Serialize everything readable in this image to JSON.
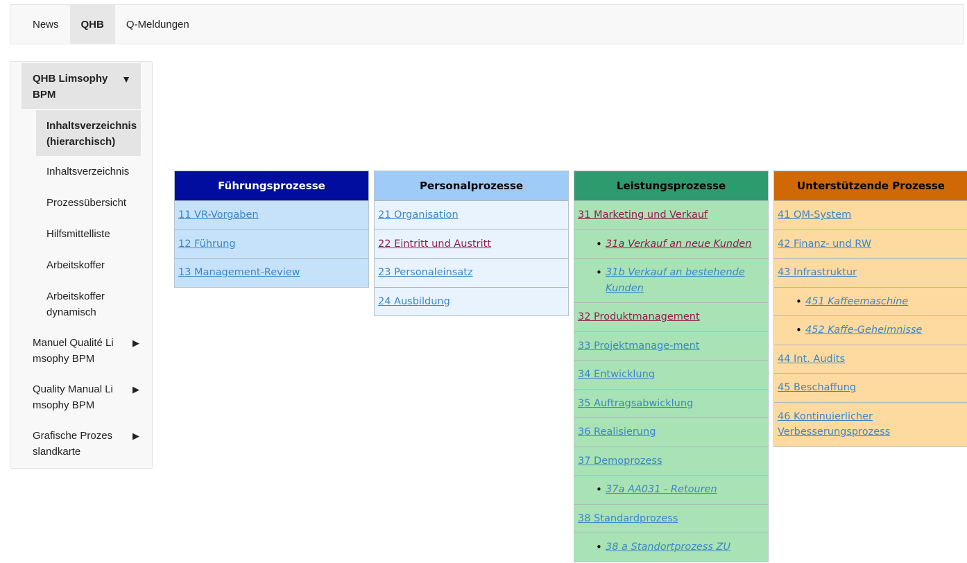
{
  "topnav": {
    "tabs": [
      "News",
      "QHB",
      "Q-Meldungen"
    ],
    "active": "QHB"
  },
  "sidebar": {
    "head": "QHB Limsophy BPM",
    "head_arrow": "▼",
    "selected": "Inhaltsverzeichnis (hierarchisch)",
    "sub_items": [
      "Inhaltsverzeichnis",
      "Prozessübersicht",
      "Hilfsmittelliste",
      "Arbeitskoffer",
      "Arbeitskoffer dynamisch"
    ],
    "top_items": [
      "Manuel Qualité Limsophy BPM",
      "Quality Manual Limsophy BPM",
      "Grafische Prozeslandkarte"
    ],
    "top_items_display": [
      "Manuel Qualité Li msophy BPM",
      "Quality Manual Li msophy BPM",
      "Grafische Prozes slandkarte"
    ],
    "top_arrow": "▶"
  },
  "columns": [
    {
      "title": "Führungsprozesse",
      "head_bg": "#000d9e",
      "head_color": "#ffffff",
      "row_bg": "#c6e2fa",
      "rows": [
        {
          "text": "11 VR-Vorgaben",
          "color": "blue",
          "sub": false
        },
        {
          "text": "12 Führung",
          "color": "blue",
          "sub": false
        },
        {
          "text": "13 Management-Review",
          "color": "blue",
          "sub": false
        }
      ]
    },
    {
      "title": "Personalprozesse",
      "head_bg": "#9ecbf8",
      "head_color": "#000000",
      "row_bg": "#e8f3fd",
      "rows": [
        {
          "text": "21 Organisation",
          "color": "blue",
          "sub": false
        },
        {
          "text": "22 Eintritt und Austritt",
          "color": "maroon",
          "sub": false
        },
        {
          "text": "23 Personaleinsatz",
          "color": "blue",
          "sub": false
        },
        {
          "text": "24 Ausbildung",
          "color": "blue",
          "sub": false
        }
      ]
    },
    {
      "title": "Leistungsprozesse",
      "head_bg": "#2d9b6e",
      "head_color": "#000000",
      "row_bg": "#a8e2b5",
      "rows": [
        {
          "text": "31 Marketing und Verkauf",
          "color": "maroon",
          "sub": false
        },
        {
          "text": "31a Verkauf an neue Kunden",
          "color": "maroon",
          "sub": true
        },
        {
          "text": "31b Verkauf an bestehende Kunden",
          "color": "blue",
          "sub": true
        },
        {
          "text": "32 Produktmanagement",
          "color": "maroon",
          "sub": false
        },
        {
          "text": "33 Projektmanage-ment",
          "color": "blue",
          "sub": false
        },
        {
          "text": "34 Entwicklung",
          "color": "blue",
          "sub": false
        },
        {
          "text": "35 Auftragsabwicklung",
          "color": "blue",
          "sub": false
        },
        {
          "text": "36 Realisierung",
          "color": "blue",
          "sub": false
        },
        {
          "text": "37 Demoprozess",
          "color": "blue",
          "sub": false
        },
        {
          "text": "37a AA031 - Retouren",
          "color": "blue",
          "sub": true
        },
        {
          "text": "38 Standardprozess",
          "color": "blue",
          "sub": false
        },
        {
          "text": "38 a Standortprozess ZU",
          "color": "blue",
          "sub": true
        }
      ]
    },
    {
      "title": "Unterstützende Prozesse",
      "head_bg": "#d06806",
      "head_color": "#000000",
      "row_bg": "#fddaa0",
      "rows": [
        {
          "text": "41 QM-System",
          "color": "blue",
          "sub": false
        },
        {
          "text": "42 Finanz- und RW",
          "color": "blue",
          "sub": false
        },
        {
          "text": "43 Infrastruktur",
          "color": "blue",
          "sub": false
        },
        {
          "text": "451 Kaffeemaschine",
          "color": "blue",
          "sub": true
        },
        {
          "text": "452 Kaffe-Geheimnisse",
          "color": "blue",
          "sub": true
        },
        {
          "text": "44 Int. Audits",
          "color": "blue",
          "sub": false
        },
        {
          "text": "45 Beschaffung",
          "color": "blue",
          "sub": false
        },
        {
          "text": "46 Kontinuierlicher Verbesserungsprozess",
          "color": "blue",
          "sub": false
        }
      ]
    }
  ]
}
